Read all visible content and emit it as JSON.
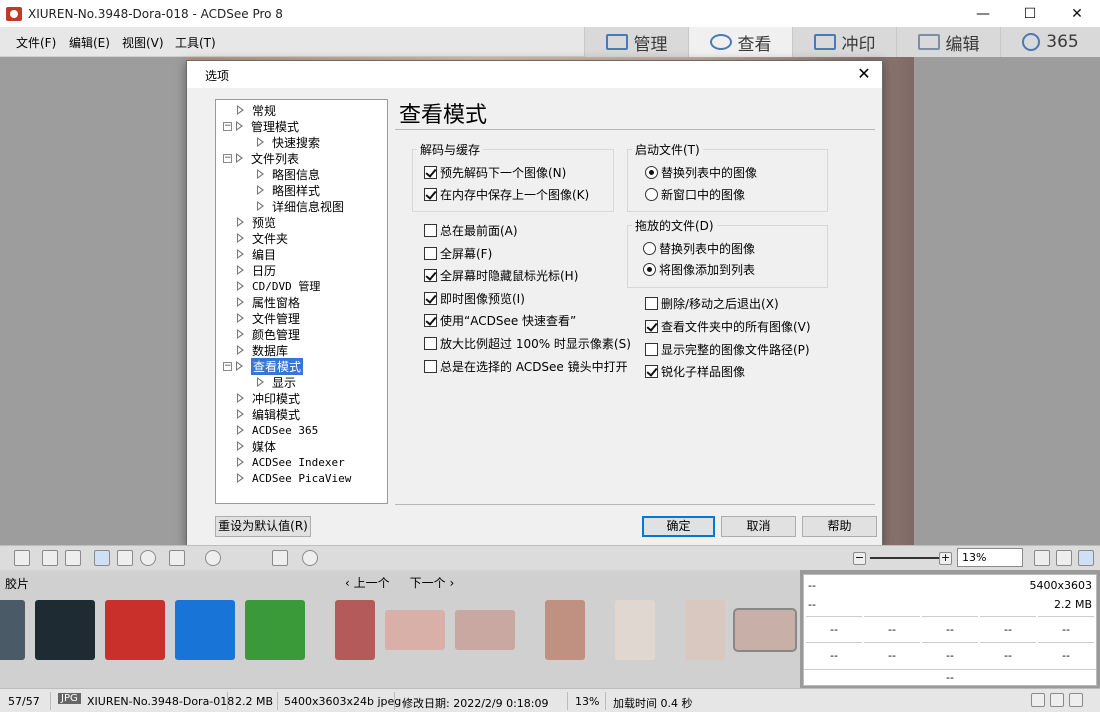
{
  "window": {
    "title": "XIUREN-No.3948-Dora-018 - ACDSee Pro 8",
    "minimize": "—",
    "maximize": "☐",
    "close": "✕"
  },
  "menu": [
    "文件(F)",
    "编辑(E)",
    "视图(V)",
    "工具(T)"
  ],
  "modes": [
    {
      "label": "管理",
      "icon": "grid-icon"
    },
    {
      "label": "查看",
      "icon": "eye-icon"
    },
    {
      "label": "冲印",
      "icon": "image-develop-icon"
    },
    {
      "label": "编辑",
      "icon": "edit-tools-icon"
    },
    {
      "label": "365",
      "icon": "acdsee365-icon"
    }
  ],
  "dialog": {
    "title": "选项",
    "close": "✕",
    "panel_title": "查看模式",
    "tree": [
      {
        "label": "常规",
        "level": 0
      },
      {
        "label": "管理模式",
        "level": 0,
        "expanded": true
      },
      {
        "label": "快速搜索",
        "level": 1
      },
      {
        "label": "文件列表",
        "level": 0,
        "expanded": true
      },
      {
        "label": "略图信息",
        "level": 1
      },
      {
        "label": "略图样式",
        "level": 1
      },
      {
        "label": "详细信息视图",
        "level": 1
      },
      {
        "label": "预览",
        "level": 0
      },
      {
        "label": "文件夹",
        "level": 0
      },
      {
        "label": "编目",
        "level": 0
      },
      {
        "label": "日历",
        "level": 0
      },
      {
        "label": "CD/DVD 管理",
        "level": 0
      },
      {
        "label": "属性窗格",
        "level": 0
      },
      {
        "label": "文件管理",
        "level": 0
      },
      {
        "label": "颜色管理",
        "level": 0
      },
      {
        "label": "数据库",
        "level": 0
      },
      {
        "label": "查看模式",
        "level": 0,
        "expanded": true,
        "selected": true
      },
      {
        "label": "显示",
        "level": 1
      },
      {
        "label": "冲印模式",
        "level": 0
      },
      {
        "label": "编辑模式",
        "level": 0
      },
      {
        "label": "ACDSee 365",
        "level": 0
      },
      {
        "label": "媒体",
        "level": 0
      },
      {
        "label": "ACDSee Indexer",
        "level": 0
      },
      {
        "label": "ACDSee PicaView",
        "level": 0
      }
    ],
    "decode_group": {
      "label": "解码与缓存",
      "items": [
        {
          "label": "预先解码下一个图像(N)",
          "checked": true
        },
        {
          "label": "在内存中保存上一个图像(K)",
          "checked": true
        }
      ]
    },
    "options_left": [
      {
        "label": "总在最前面(A)",
        "checked": false
      },
      {
        "label": "全屏幕(F)",
        "checked": false
      },
      {
        "label": "全屏幕时隐藏鼠标光标(H)",
        "checked": true
      },
      {
        "label": "即时图像预览(I)",
        "checked": true
      },
      {
        "label": "使用“ACDSee 快速查看”",
        "checked": true
      },
      {
        "label": "放大比例超过 100% 时显示像素(S)",
        "checked": false
      },
      {
        "label": "总是在选择的 ACDSee 镜头中打开",
        "checked": false
      }
    ],
    "startup_group": {
      "label": "启动文件(T)",
      "items": [
        {
          "label": "替换列表中的图像",
          "checked": true
        },
        {
          "label": "新窗口中的图像",
          "checked": false
        }
      ]
    },
    "dropped_group": {
      "label": "拖放的文件(D)",
      "items": [
        {
          "label": "替换列表中的图像",
          "checked": false
        },
        {
          "label": "将图像添加到列表",
          "checked": true
        }
      ]
    },
    "options_right": [
      {
        "label": "删除/移动之后退出(X)",
        "checked": false
      },
      {
        "label": "查看文件夹中的所有图像(V)",
        "checked": true
      },
      {
        "label": "显示完整的图像文件路径(P)",
        "checked": false
      },
      {
        "label": "锐化子样品图像",
        "checked": true
      }
    ],
    "buttons": {
      "reset": "重设为默认值(R)",
      "ok": "确定",
      "cancel": "取消",
      "help": "帮助"
    }
  },
  "toolbar": {
    "zoom_value": "13%",
    "zoom_minus": "−",
    "zoom_plus": "+"
  },
  "filmstrip": {
    "label": "胶片",
    "prev": "‹ 上一个",
    "next": "下一个 ›",
    "thumbs": [
      {
        "icon": "app-icon-gray",
        "color": "#4a5a66"
      },
      {
        "icon": "transfer-app-icon",
        "color": "#1f2b33"
      },
      {
        "icon": "pdf-app-icon",
        "color": "#c9302c"
      },
      {
        "icon": "j-app-icon",
        "color": "#1874d6"
      },
      {
        "icon": "image-refresh-app-icon",
        "color": "#3a9a3a"
      },
      {
        "icon": "photo-thumb",
        "color": "#b45a5a"
      },
      {
        "icon": "photo-thumb",
        "color": "#d8b0a8"
      },
      {
        "icon": "photo-thumb",
        "color": "#c8a8a0"
      },
      {
        "icon": "photo-thumb",
        "color": "#c09080"
      },
      {
        "icon": "photo-thumb",
        "color": "#e0d8d0"
      },
      {
        "icon": "photo-thumb",
        "color": "#d8c8c0"
      },
      {
        "icon": "photo-thumb",
        "color": "#c8b0a8"
      }
    ]
  },
  "info_panel": {
    "row1_left": "--",
    "row1_right": "5400x3603",
    "row2_left": "--",
    "row2_right": "2.2 MB",
    "cells": [
      "--",
      "--",
      "--",
      "--",
      "--",
      "--",
      "--",
      "--",
      "--",
      "--"
    ],
    "bottom": "--"
  },
  "status": {
    "count": "57/57",
    "type": "JPG",
    "file": "XIUREN-No.3948-Dora-018",
    "size": "2.2 MB",
    "dims": "5400x3603x24b jpeg",
    "modified": "修改日期: 2022/2/9 0:18:09",
    "zoom": "13%",
    "load": "加载时间 0.4 秒"
  }
}
